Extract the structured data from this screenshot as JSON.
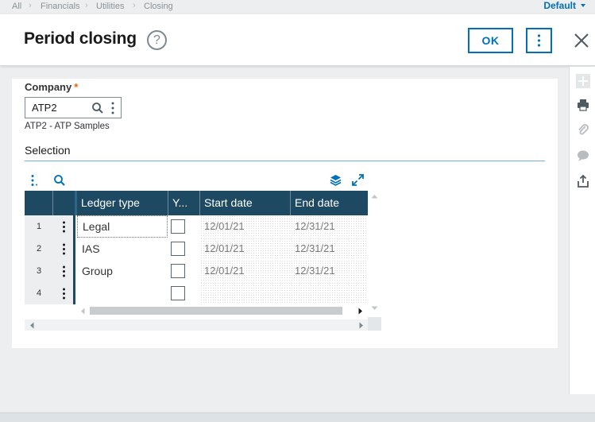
{
  "breadcrumb": {
    "items": [
      "All",
      "Financials",
      "Utilities",
      "Closing"
    ]
  },
  "profile": {
    "label": "Default"
  },
  "header": {
    "title": "Period closing",
    "help_symbol": "?",
    "ok_label": "OK"
  },
  "company": {
    "label": "Company",
    "required_mark": "*",
    "value": "ATP2",
    "description": "ATP2 - ATP Samples"
  },
  "selection": {
    "title": "Selection",
    "columns": [
      "Ledger type",
      "Y...",
      "Start date",
      "End date"
    ],
    "rows": [
      {
        "num": "1",
        "ledger": "Legal",
        "year": false,
        "start": "12/01/21",
        "end": "12/31/21"
      },
      {
        "num": "2",
        "ledger": "IAS",
        "year": false,
        "start": "12/01/21",
        "end": "12/31/21"
      },
      {
        "num": "3",
        "ledger": "Group",
        "year": false,
        "start": "12/01/21",
        "end": "12/31/21"
      },
      {
        "num": "4",
        "ledger": "",
        "year": false,
        "start": "",
        "end": ""
      }
    ]
  },
  "right_toolbar": [
    "plus-icon",
    "print-icon",
    "attachment-icon",
    "comment-icon",
    "export-icon"
  ],
  "colors": {
    "accent": "#0070b8",
    "grid_header": "#1d4a62",
    "required": "#e96400"
  }
}
